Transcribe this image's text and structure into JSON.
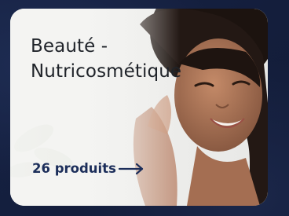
{
  "card": {
    "title_line1": "Beauté -",
    "title_line2": "Nutricosmétique",
    "link_label": "26 produits",
    "link_icon": "arrow-right-icon",
    "image_subject": "photo-woman-smiling"
  },
  "colors": {
    "page_background": "#141e3a",
    "title_text": "#1f2329",
    "link_text": "#1c2e5a",
    "card_background": "#f1f1f0"
  }
}
